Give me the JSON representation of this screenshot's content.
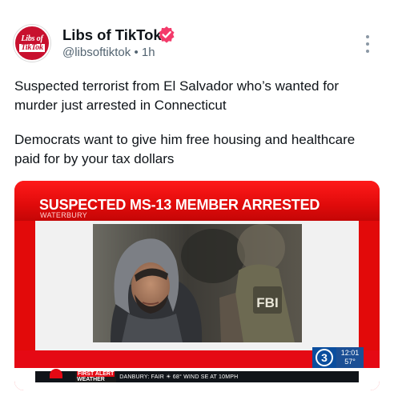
{
  "account": {
    "name": "Libs of TikTok",
    "handle": "@libsoftiktok",
    "separator": "•",
    "time": "1h",
    "avatar_line1": "Libs of",
    "avatar_line2": "TikTok",
    "verified_color": "#f33a6a"
  },
  "post": {
    "paragraph1": "Suspected terrorist from El Salvador who’s wanted for murder just arrested in Connecticut",
    "paragraph2": "Democrats want to give him free housing and healthcare paid for by your tax dollars"
  },
  "media": {
    "headline": "SUSPECTED MS-13 MEMBER ARRESTED",
    "location": "WATERBURY",
    "station_logo": "3",
    "clock_time": "12:01",
    "temperature": "57°",
    "ticker_label_1": "FIRST ALERT",
    "ticker_label_2": "WEATHER",
    "ticker_text": "DANBURY: FAIR  ☀  68°  WIND SE AT 10MPH",
    "vest_text": "FBI"
  },
  "colors": {
    "news_red": "#e50914",
    "station_blue": "#0b4e9e"
  },
  "icons": {
    "verified": "verified-badge-icon",
    "more": "more-options-icon"
  }
}
